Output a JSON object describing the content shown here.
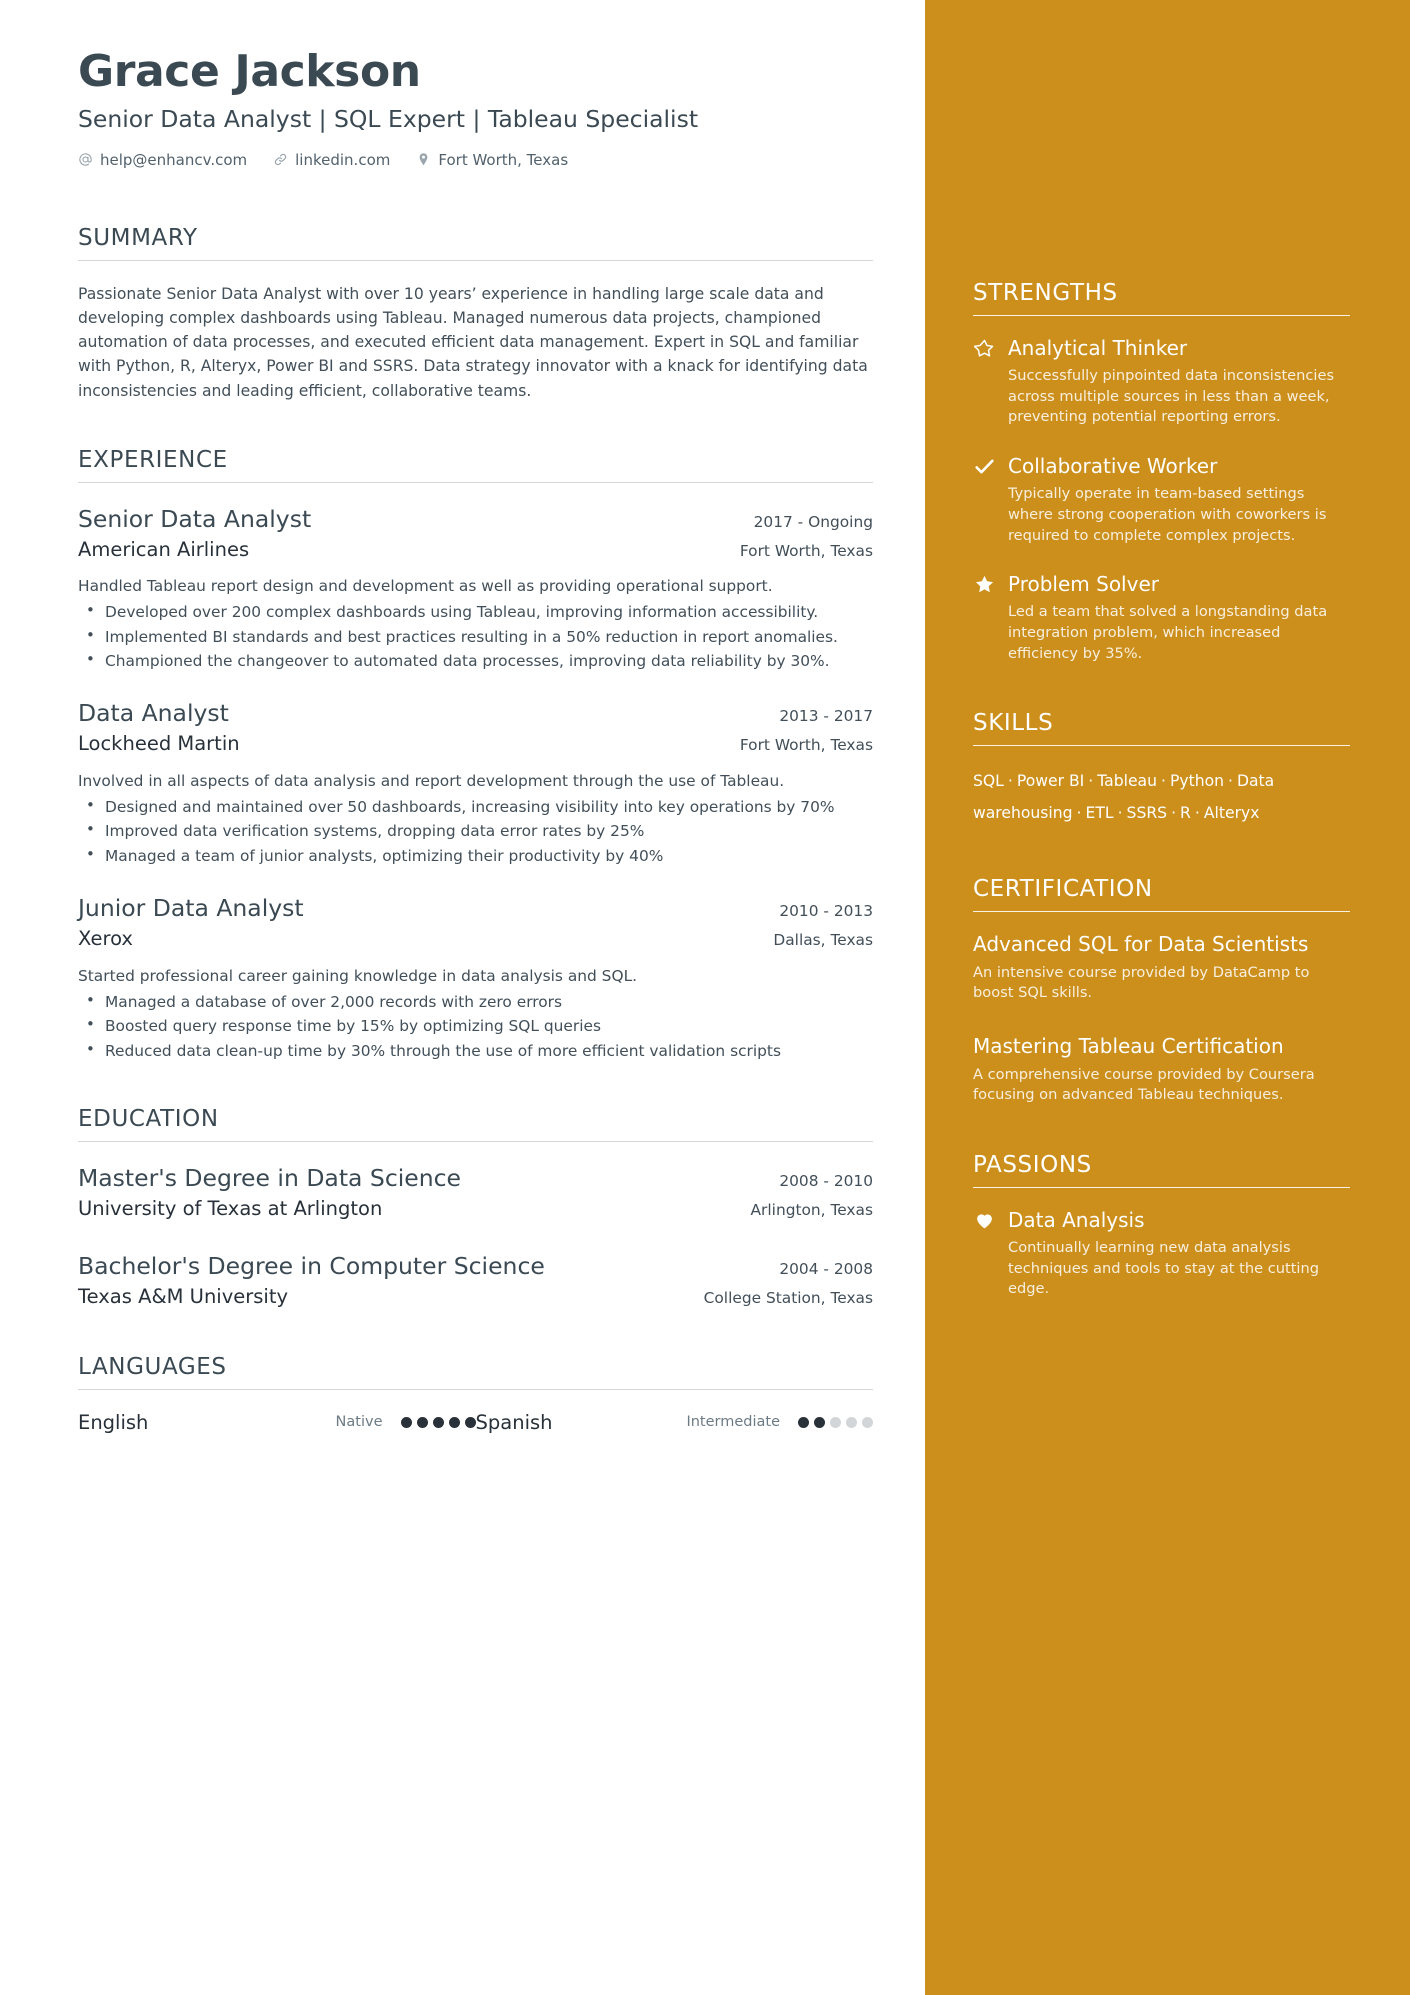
{
  "theme": {
    "sidebar_color": "#CC8F1C",
    "text_dark": "#3B4953",
    "text_body": "#424F59",
    "rule_color": "#D4D7D9"
  },
  "header": {
    "name": "Grace Jackson",
    "headline": "Senior Data Analyst | SQL Expert | Tableau Specialist",
    "contacts": [
      {
        "icon": "at-icon",
        "text": "help@enhancv.com"
      },
      {
        "icon": "link-icon",
        "text": "linkedin.com"
      },
      {
        "icon": "location-pin-icon",
        "text": "Fort Worth, Texas"
      }
    ]
  },
  "summary": {
    "title": "SUMMARY",
    "text": "Passionate Senior Data Analyst with over 10 years’ experience in handling large scale data and developing complex dashboards using Tableau. Managed numerous data projects, championed automation of data processes, and executed efficient data management. Expert in SQL and familiar with Python, R, Alteryx, Power BI and SSRS. Data strategy innovator with a knack for identifying data inconsistencies and leading efficient, collaborative teams."
  },
  "experience": {
    "title": "EXPERIENCE",
    "entries": [
      {
        "role": "Senior Data Analyst",
        "dates": "2017 - Ongoing",
        "company": "American Airlines",
        "location": "Fort Worth, Texas",
        "description": "Handled Tableau report design and development as well as providing operational support.",
        "bullets": [
          "Developed over 200 complex dashboards using Tableau, improving information accessibility.",
          "Implemented BI standards and best practices resulting in a 50% reduction in report anomalies.",
          "Championed the changeover to automated data processes, improving data reliability by 30%."
        ]
      },
      {
        "role": "Data Analyst",
        "dates": "2013 - 2017",
        "company": "Lockheed Martin",
        "location": "Fort Worth, Texas",
        "description": "Involved in all aspects of data analysis and report development through the use of Tableau.",
        "bullets": [
          "Designed and maintained over 50 dashboards, increasing visibility into key operations by 70%",
          "Improved data verification systems, dropping data error rates by 25%",
          "Managed a team of junior analysts, optimizing their productivity by 40%"
        ]
      },
      {
        "role": "Junior Data Analyst",
        "dates": "2010 - 2013",
        "company": "Xerox",
        "location": "Dallas, Texas",
        "description": "Started professional career gaining knowledge in data analysis and SQL.",
        "bullets": [
          "Managed a database of over 2,000 records with zero errors",
          "Boosted query response time by 15% by optimizing SQL queries",
          "Reduced data clean-up time by 30% through the use of more efficient validation scripts"
        ]
      }
    ]
  },
  "education": {
    "title": "EDUCATION",
    "entries": [
      {
        "degree": "Master's Degree in Data Science",
        "dates": "2008 - 2010",
        "school": "University of Texas at Arlington",
        "location": "Arlington, Texas"
      },
      {
        "degree": "Bachelor's Degree in Computer Science",
        "dates": "2004 - 2008",
        "school": "Texas A&M University",
        "location": "College Station, Texas"
      }
    ]
  },
  "languages": {
    "title": "LANGUAGES",
    "items": [
      {
        "name": "English",
        "level": "Native",
        "filled": 5,
        "total": 5
      },
      {
        "name": "Spanish",
        "level": "Intermediate",
        "filled": 2,
        "total": 5
      }
    ]
  },
  "strengths": {
    "title": "STRENGTHS",
    "items": [
      {
        "icon": "star-outline-icon",
        "title": "Analytical Thinker",
        "desc": "Successfully pinpointed data inconsistencies across multiple sources in less than a week, preventing potential reporting errors."
      },
      {
        "icon": "check-icon",
        "title": "Collaborative Worker",
        "desc": "Typically operate in team-based settings where strong cooperation with coworkers is required to complete complex projects."
      },
      {
        "icon": "star-filled-icon",
        "title": "Problem Solver",
        "desc": "Led a team that solved a longstanding data integration problem, which increased efficiency by 35%."
      }
    ]
  },
  "skills": {
    "title": "SKILLS",
    "items": [
      "SQL",
      "Power BI",
      "Tableau",
      "Python",
      "Data warehousing",
      "ETL",
      "SSRS",
      "R",
      "Alteryx"
    ],
    "separator": "·"
  },
  "certification": {
    "title": "CERTIFICATION",
    "items": [
      {
        "name": "Advanced SQL for Data Scientists",
        "desc": "An intensive course provided by DataCamp to boost SQL skills."
      },
      {
        "name": "Mastering Tableau Certification",
        "desc": "A comprehensive course provided by Coursera focusing on advanced Tableau techniques."
      }
    ]
  },
  "passions": {
    "title": "PASSIONS",
    "items": [
      {
        "icon": "heart-icon",
        "title": "Data Analysis",
        "desc": "Continually learning new data analysis techniques and tools to stay at the cutting edge."
      }
    ]
  }
}
